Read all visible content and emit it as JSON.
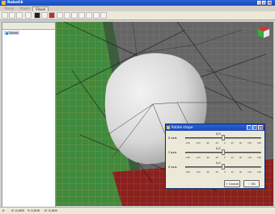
{
  "window": {
    "title": "Robotik"
  },
  "tabs": [
    {
      "label": "Kanal"
    },
    {
      "label": "Objekt"
    },
    {
      "label": "Visual"
    }
  ],
  "scene": {
    "label": "Szene"
  },
  "status": {
    "field1": "0",
    "field2": "X: 0,000",
    "field3": "Y: 0,000",
    "field4": "Z: 0,000"
  },
  "dialog": {
    "title": "Rotate shape",
    "rows": [
      {
        "label": "X axis",
        "value": "0,0",
        "level": 0.5
      },
      {
        "label": "Y axis",
        "value": "0,0",
        "level": 0.5
      },
      {
        "label": "Z axis",
        "value": "0,0",
        "level": 0.5
      }
    ],
    "ticks": [
      "-180",
      "-135",
      "-90",
      "-45",
      "0",
      "45",
      "90",
      "135",
      "180"
    ],
    "buttons": {
      "cancel": "Cancel",
      "ok": "OK"
    }
  },
  "colors": {
    "green_plane": "#3e8a3e",
    "red_plane": "#8a2020",
    "gray_plane": "#6a6a6a",
    "sphere": "#e0e0e0"
  }
}
